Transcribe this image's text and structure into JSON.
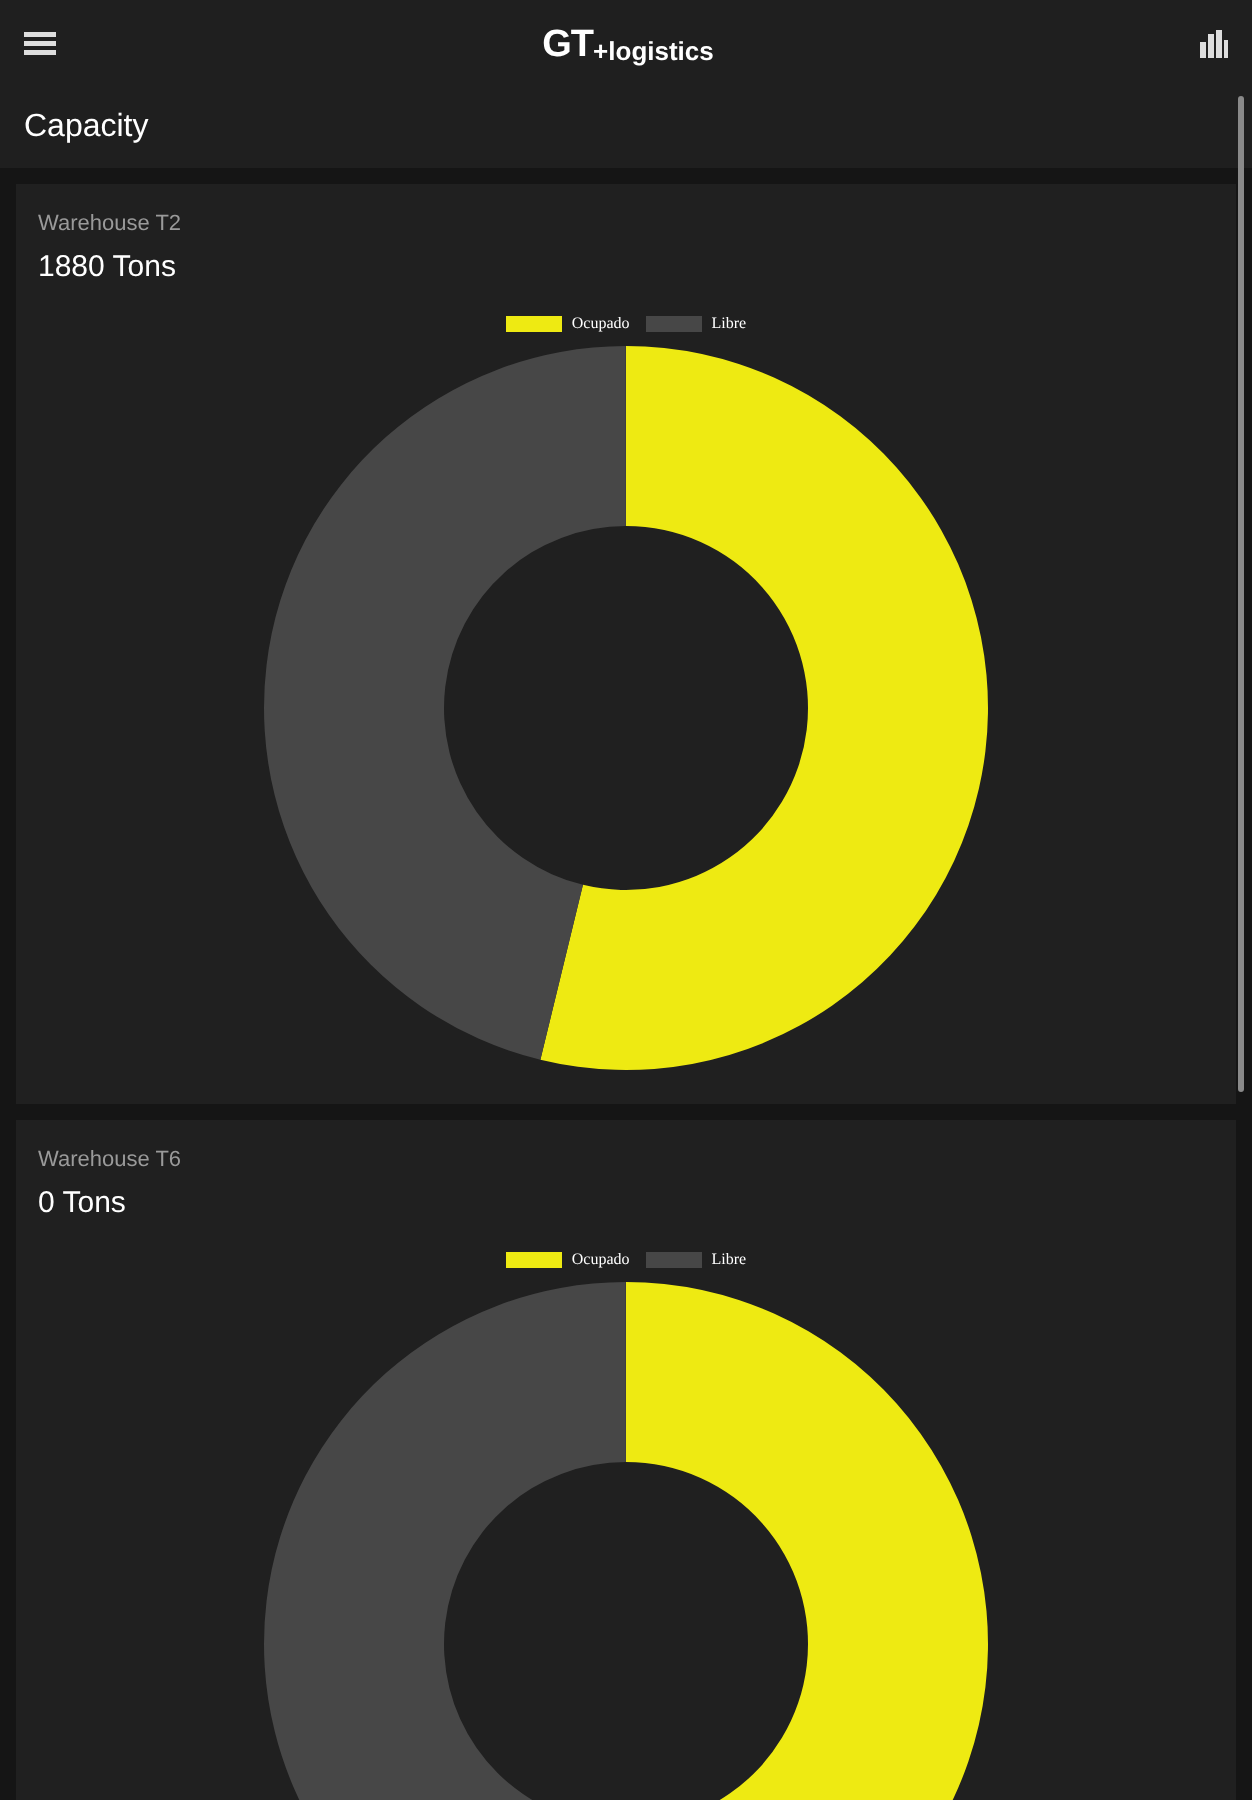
{
  "header": {
    "logo_mark": "GT",
    "logo_text": "+logistics"
  },
  "page_title": "Capacity",
  "cards": [
    {
      "label": "Warehouse T2",
      "value": "1880 Tons",
      "legend": [
        {
          "label": "Ocupado",
          "color": "#eeea12"
        },
        {
          "label": "Libre",
          "color": "#474747"
        }
      ]
    },
    {
      "label": "Warehouse T6",
      "value": "0 Tons",
      "legend": [
        {
          "label": "Ocupado",
          "color": "#eeea12"
        },
        {
          "label": "Libre",
          "color": "#474747"
        }
      ]
    }
  ]
}
